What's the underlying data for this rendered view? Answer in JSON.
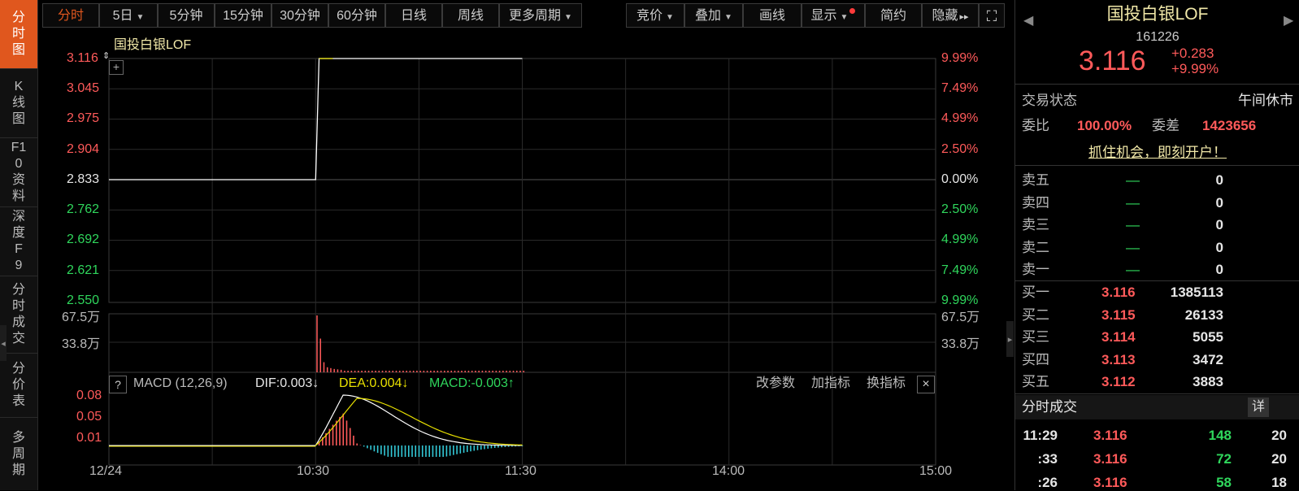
{
  "left_tabs": [
    {
      "label": "分时图",
      "active": true
    },
    {
      "label": "K线图",
      "active": false
    },
    {
      "label": "F10资料",
      "active": false
    },
    {
      "label": "深度F9",
      "active": false
    },
    {
      "label": "分时成交",
      "active": false
    },
    {
      "label": "分价表",
      "active": false
    },
    {
      "label": "多周期",
      "active": false
    }
  ],
  "toolbar": {
    "period_tabs": [
      "分时",
      "5日",
      "5分钟",
      "15分钟",
      "30分钟",
      "60分钟",
      "日线",
      "周线",
      "更多周期"
    ],
    "tools": [
      "竞价",
      "叠加",
      "画线",
      "显示",
      "简约",
      "隐藏"
    ],
    "collapse_glyph": "▸▸",
    "fullscreen_glyph": "⛶"
  },
  "chart": {
    "title": "国投白银LOF",
    "price_labels": [
      "3.116",
      "3.045",
      "2.975",
      "2.904",
      "2.833",
      "2.762",
      "2.692",
      "2.621",
      "2.550"
    ],
    "pct_labels": [
      "9.99%",
      "7.49%",
      "4.99%",
      "2.50%",
      "0.00%",
      "2.50%",
      "4.99%",
      "7.49%",
      "9.99%"
    ],
    "vol_labels": [
      "67.5万",
      "33.8万"
    ],
    "time_labels": [
      "12/24",
      "10:30",
      "11:30",
      "14:00",
      "15:00"
    ],
    "add_glyph": "+"
  },
  "chart_data": [
    {
      "type": "line",
      "series": [
        {
          "name": "国投白银LOF",
          "x": [
            "09:30",
            "10:30",
            "10:31",
            "10:35",
            "11:30"
          ],
          "values": [
            2.833,
            2.833,
            3.116,
            3.116,
            3.116
          ]
        }
      ],
      "ylim": [
        2.55,
        3.116
      ],
      "prev_close": 2.833
    },
    {
      "type": "bar",
      "x": [
        "10:30",
        "10:31",
        "10:32",
        "10:33",
        "10:34",
        "10:35",
        "10:36",
        "10:37"
      ],
      "values": [
        67.5,
        40,
        12,
        6,
        5,
        4,
        3.5,
        3
      ],
      "unit": "万"
    }
  ],
  "macd": {
    "help": "?",
    "name": "MACD (12,26,9)",
    "dif": "DIF:0.003↓",
    "dea": "DEA:0.004↓",
    "macd": "MACD:-0.003↑",
    "actions": [
      "改参数",
      "加指标",
      "换指标"
    ],
    "close": "×",
    "y_labels": [
      "0.08",
      "0.05",
      "0.01"
    ]
  },
  "quote": {
    "name": "国投白银LOF",
    "code": "161226",
    "price": "3.116",
    "change": "+0.283",
    "change_pct": "+9.99%",
    "status_label": "交易状态",
    "status_value": "午间休市",
    "wb_label": "委比",
    "wb_value": "100.00%",
    "wc_label": "委差",
    "wc_value": "1423656",
    "promo": "抓住机会，即刻开户！",
    "prev_arrow": "◀",
    "next_arrow": "▶",
    "asks": [
      {
        "label": "卖五",
        "price": "—",
        "vol": "0"
      },
      {
        "label": "卖四",
        "price": "—",
        "vol": "0"
      },
      {
        "label": "卖三",
        "price": "—",
        "vol": "0"
      },
      {
        "label": "卖二",
        "price": "—",
        "vol": "0"
      },
      {
        "label": "卖一",
        "price": "—",
        "vol": "0"
      }
    ],
    "bids": [
      {
        "label": "买一",
        "price": "3.116",
        "vol": "1385113"
      },
      {
        "label": "买二",
        "price": "3.115",
        "vol": "26133"
      },
      {
        "label": "买三",
        "price": "3.114",
        "vol": "5055"
      },
      {
        "label": "买四",
        "price": "3.113",
        "vol": "3472"
      },
      {
        "label": "买五",
        "price": "3.112",
        "vol": "3883"
      }
    ]
  },
  "ticks": {
    "title": "分时成交",
    "detail": "详",
    "rows": [
      {
        "time": "11:29",
        "price": "3.116",
        "vol": "148",
        "n": "20"
      },
      {
        "time": ":33",
        "price": "3.116",
        "vol": "72",
        "n": "20"
      },
      {
        "time": ":26",
        "price": "3.116",
        "vol": "58",
        "n": "18"
      }
    ]
  },
  "colors": {
    "up": "#ff5a5a",
    "down": "#2fd65c",
    "accent": "#e0571e",
    "price_line": "#ffffff",
    "dea_line": "#e8e000"
  }
}
